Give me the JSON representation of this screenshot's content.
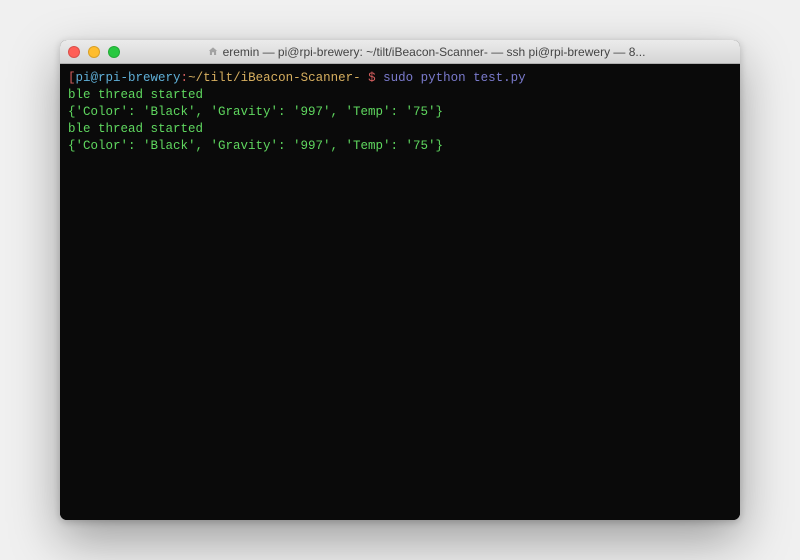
{
  "titlebar": {
    "title": "eremin — pi@rpi-brewery: ~/tilt/iBeacon-Scanner- — ssh pi@rpi-brewery — 8..."
  },
  "prompt": {
    "open_bracket": "[",
    "user_host": "pi@rpi-brewery",
    "colon": ":",
    "path": "~/tilt/iBeacon-Scanner-",
    "close_bracket": " $",
    "command": "sudo python test.py"
  },
  "output_lines": [
    "ble thread started",
    "{'Color': 'Black', 'Gravity': '997', 'Temp': '75'}",
    "ble thread started",
    "{'Color': 'Black', 'Gravity': '997', 'Temp': '75'}"
  ]
}
